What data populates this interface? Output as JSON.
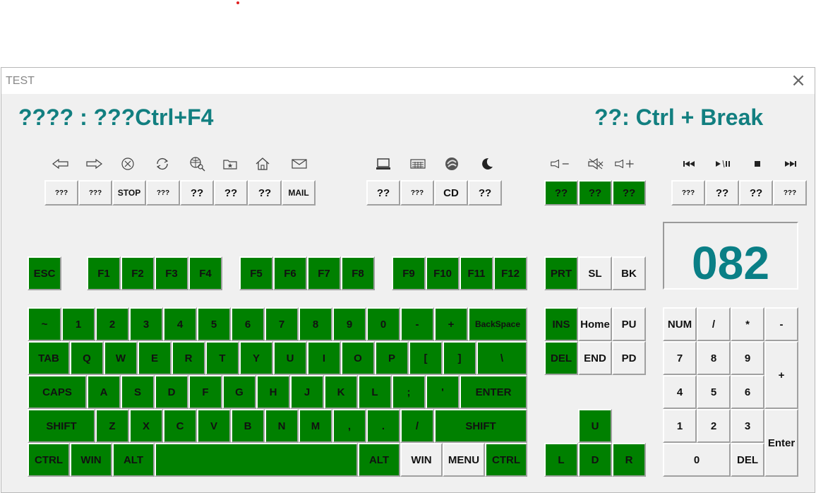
{
  "window": {
    "title": "TEST",
    "close_glyph": "×"
  },
  "header": {
    "left": "???? : ???Ctrl+F4",
    "right": "??: Ctrl + Break"
  },
  "display": {
    "value": "082"
  },
  "colors": {
    "key_active": "#008000",
    "key_idle": "#f0f0f0",
    "accent_text": "#127f80"
  },
  "media_icons": [
    "back-arrow-icon",
    "forward-arrow-icon",
    "stop-circle-icon",
    "refresh-icon",
    "search-globe-icon",
    "favorites-folder-icon",
    "home-icon",
    "mail-icon",
    "computer-icon",
    "calculator-icon",
    "media-player-icon",
    "sleep-moon-icon",
    "volume-down-icon",
    "mute-icon",
    "volume-up-icon",
    "previous-track-icon",
    "play-pause-icon",
    "stop-square-icon",
    "next-track-icon"
  ],
  "keys": {
    "m1": "???",
    "m2": "???",
    "m3": "STOP",
    "m4": "???",
    "m5": "??",
    "m6": "??",
    "m7": "??",
    "m8": "MAIL",
    "s1": "??",
    "s2": "???",
    "s3": "CD",
    "s4": "??",
    "v1": "??",
    "v2": "??",
    "v3": "??",
    "p1": "???",
    "p2": "??",
    "p3": "??",
    "p4": "???",
    "esc": "ESC",
    "f1": "F1",
    "f2": "F2",
    "f3": "F3",
    "f4": "F4",
    "f5": "F5",
    "f6": "F6",
    "f7": "F7",
    "f8": "F8",
    "f9": "F9",
    "f10": "F10",
    "f11": "F11",
    "f12": "F12",
    "prt": "PRT",
    "sl": "SL",
    "bk": "BK",
    "tilde": "~",
    "n1": "1",
    "n2": "2",
    "n3": "3",
    "n4": "4",
    "n5": "5",
    "n6": "6",
    "n7": "7",
    "n8": "8",
    "n9": "9",
    "n0": "0",
    "minus": "-",
    "plus": "+",
    "backspace": "BackSpace",
    "tab": "TAB",
    "q": "Q",
    "w": "W",
    "e": "E",
    "r": "R",
    "t": "T",
    "y": "Y",
    "u": "U",
    "i": "I",
    "o": "O",
    "p": "P",
    "lbr": "[",
    "rbr": "]",
    "bslash": "\\",
    "caps": "CAPS",
    "a": "A",
    "s": "S",
    "d": "D",
    "f": "F",
    "g": "G",
    "h": "H",
    "j": "J",
    "k": "K",
    "l": "L",
    "semi": ";",
    "quote": "'",
    "enter": "ENTER",
    "lshift": "SHIFT",
    "z": "Z",
    "x": "X",
    "c": "C",
    "v": "V",
    "b": "B",
    "n": "N",
    "m": "M",
    "comma": ",",
    "period": ".",
    "slash": "/",
    "rshift": "SHIFT",
    "lctrl": "CTRL",
    "lwin": "WIN",
    "lalt": "ALT",
    "space": "",
    "ralt": "ALT",
    "rwin": "WIN",
    "menu": "MENU",
    "rctrl": "CTRL",
    "ins": "INS",
    "home": "Home",
    "pu": "PU",
    "del": "DEL",
    "end": "END",
    "pd": "PD",
    "up": "U",
    "left": "L",
    "down": "D",
    "right": "R",
    "num": "NUM",
    "kdiv": "/",
    "kmul": "*",
    "kminus": "-",
    "k7": "7",
    "k8": "8",
    "k9": "9",
    "kplus": "+",
    "k4": "4",
    "k5": "5",
    "k6": "6",
    "k1": "1",
    "k2": "2",
    "k3": "3",
    "kenter": "Enter",
    "k0": "0",
    "kdel": "DEL"
  }
}
